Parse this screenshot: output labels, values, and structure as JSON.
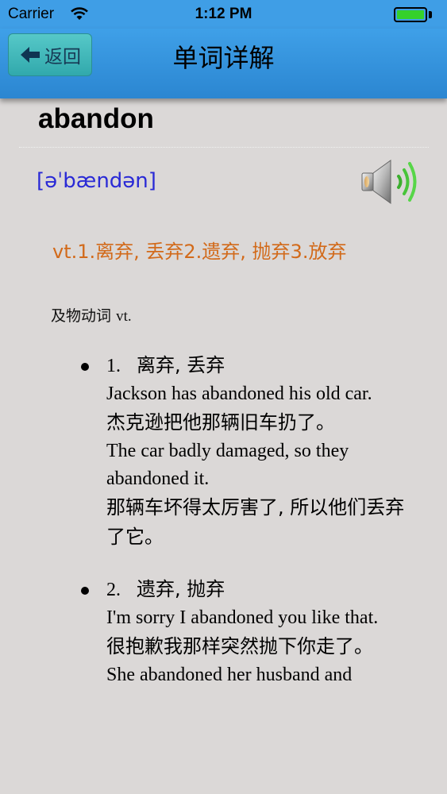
{
  "status_bar": {
    "carrier": "Carrier",
    "time": "1:12 PM"
  },
  "nav": {
    "back_label": "返回",
    "title": "单词详解"
  },
  "word": "abandon",
  "phonetic": "[əˈbændən]",
  "summary": "vt.1.离弃, 丢弃2.遗弃, 抛弃3.放弃",
  "pos_label_zh": "及物动词",
  "pos_label_abbr": "vt.",
  "definitions": [
    {
      "num": "1.",
      "meaning": "离弃, 丢弃",
      "examples": [
        {
          "en": "Jackson has abandoned his old car.",
          "zh": "杰克逊把他那辆旧车扔了。"
        },
        {
          "en": "The car badly damaged, so they abandoned it.",
          "zh": "那辆车坏得太厉害了, 所以他们丢弃了它。"
        }
      ]
    },
    {
      "num": "2.",
      "meaning": "遗弃, 抛弃",
      "examples": [
        {
          "en": "I'm sorry I abandoned you like that.",
          "zh": "很抱歉我那样突然抛下你走了。"
        },
        {
          "en": "She abandoned her husband and",
          "zh": ""
        }
      ]
    }
  ],
  "colors": {
    "nav_bg": "#2b86d1",
    "phonetic": "#2a2ad6",
    "summary": "#d26a1a",
    "background": "#dbd8d7"
  },
  "icons": {
    "back": "arrow-left-icon",
    "speaker": "speaker-icon",
    "wifi": "wifi-icon",
    "battery": "battery-icon"
  }
}
